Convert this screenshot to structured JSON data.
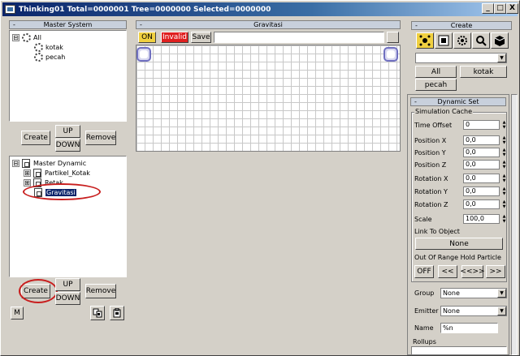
{
  "window": {
    "title": "Thinking01  Total=0000001  Tree=0000000  Selected=0000000",
    "minimize": "_",
    "restore": "□",
    "close": "X"
  },
  "master_system": {
    "header": "Master System",
    "collapse": "-",
    "tree": [
      {
        "label": "All",
        "expander": "⊟"
      },
      {
        "label": "kotak"
      },
      {
        "label": "pecah"
      }
    ],
    "buttons": {
      "create": "Create",
      "up": "UP",
      "down": "DOWN",
      "remove": "Remove"
    }
  },
  "master_dynamic": {
    "tree": [
      {
        "label": "Master Dynamic",
        "expander": "⊟"
      },
      {
        "label": "Partikel_Kotak",
        "expander": "⊞"
      },
      {
        "label": "Retak",
        "expander": "⊞"
      },
      {
        "label": "Gravitasi",
        "selected": true
      }
    ],
    "buttons": {
      "create": "Create",
      "up": "UP",
      "down": "DOWN",
      "remove": "Remove",
      "m": "M"
    }
  },
  "graph": {
    "header": "Gravitasi",
    "collapse": "-",
    "on_label": "ON",
    "status_label": "Invalid",
    "save_label": "Save",
    "name_value": ""
  },
  "create_panel": {
    "header": "Create",
    "collapse": "-",
    "dropdown_value": "",
    "buttons": {
      "all": "All",
      "kotak": "kotak",
      "pecah": "pecah"
    }
  },
  "dynamic_set": {
    "header": "Dynamic Set",
    "collapse": "-",
    "group_title": "Simulation Cache",
    "fields": [
      {
        "label": "Time Offset",
        "value": "0"
      },
      {
        "label": "Position X",
        "value": "0,0"
      },
      {
        "label": "Position Y",
        "value": "0,0"
      },
      {
        "label": "Position Z",
        "value": "0,0"
      },
      {
        "label": "Rotation X",
        "value": "0,0"
      },
      {
        "label": "Rotation Y",
        "value": "0,0"
      },
      {
        "label": "Rotation Z",
        "value": "0,0"
      },
      {
        "label": "Scale",
        "value": "100,0"
      }
    ],
    "link_label": "Link To Object",
    "link_value": "None",
    "out_of_range_label": "Out Of Range Hold Particle",
    "range_buttons": [
      "OFF",
      "<<",
      "<<>>",
      ">>"
    ],
    "group_label": "Group",
    "group_value": "None",
    "emitter_label": "Emitter",
    "emitter_value": "None",
    "name_label": "Name",
    "name_value": "%n",
    "rollups_label": "Rollups"
  },
  "colors": {
    "title_start": "#0a246a",
    "title_end": "#a6caf0",
    "panel_header": "#c8d0dc",
    "on_button": "#f0d040",
    "invalid_button": "#e02020",
    "annotation_circle": "#c81e1e",
    "selection": "#0a246a"
  }
}
